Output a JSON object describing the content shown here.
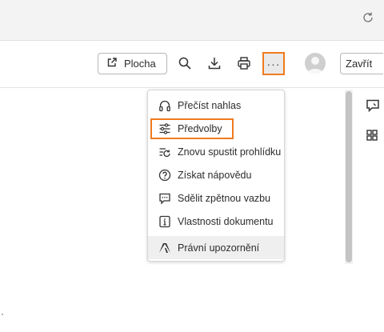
{
  "toolbar": {
    "desktop_label": "Plocha",
    "close_label": "Zavřít",
    "more_label": "···"
  },
  "menu": {
    "items": [
      {
        "label": "Přečíst nahlas",
        "icon": "headphones-icon"
      },
      {
        "label": "Předvolby",
        "icon": "sliders-icon"
      },
      {
        "label": "Znovu spustit prohlídku",
        "icon": "restart-tour-icon"
      },
      {
        "label": "Získat nápovědu",
        "icon": "help-icon"
      },
      {
        "label": "Sdělit zpětnou vazbu",
        "icon": "feedback-icon"
      },
      {
        "label": "Vlastnosti dokumentu",
        "icon": "info-icon"
      },
      {
        "label": "Právní upozornění",
        "icon": "adobe-icon"
      }
    ]
  },
  "colors": {
    "accent_highlight": "#f07b1e",
    "menu_hover": "#efefef",
    "topbar": "#f3f3f3"
  }
}
